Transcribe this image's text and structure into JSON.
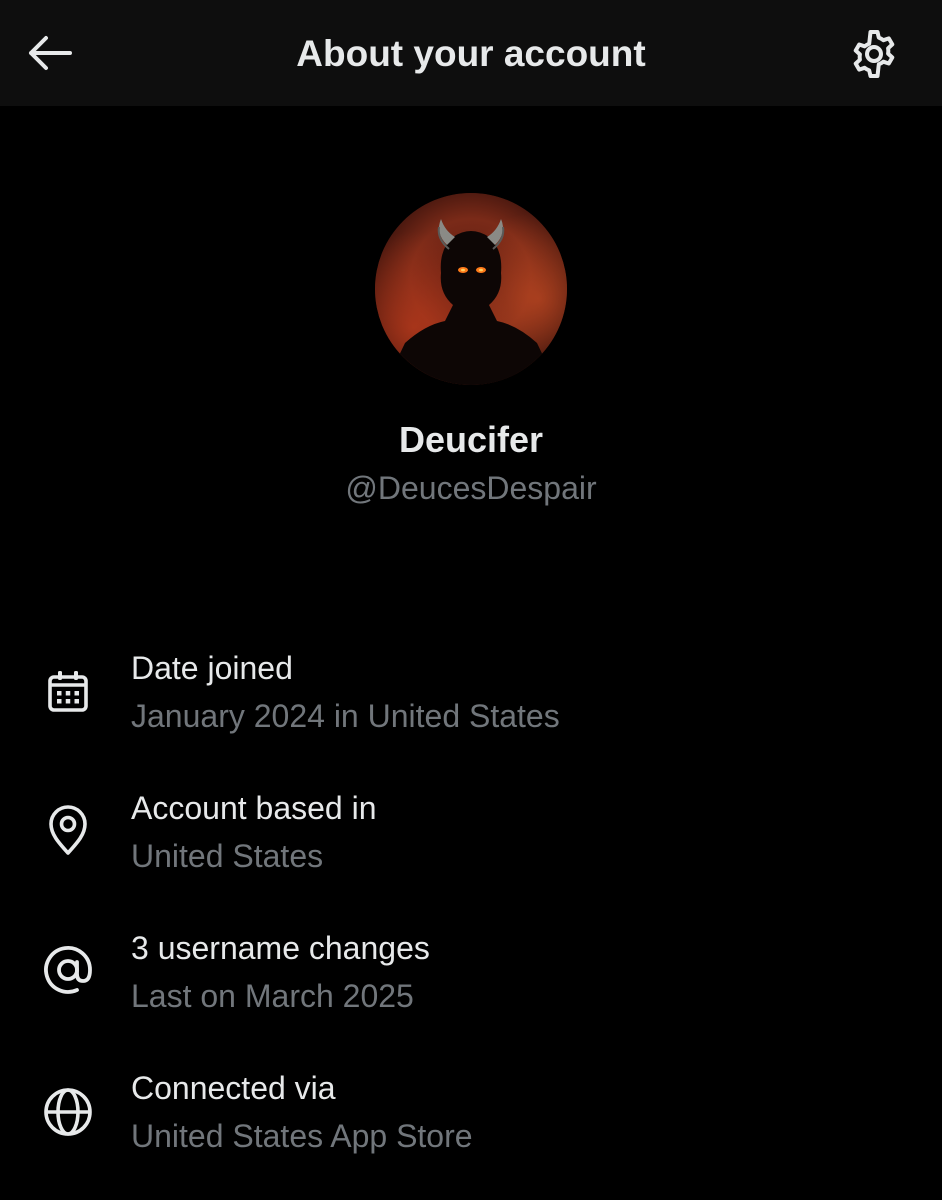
{
  "header": {
    "title": "About your account",
    "back_icon": "arrow-left-icon",
    "settings_icon": "gear-icon"
  },
  "profile": {
    "name": "Deucifer",
    "handle": "@DeucesDespair",
    "avatar": "dark-horned-figure-avatar"
  },
  "rows": [
    {
      "icon": "calendar-icon",
      "title": "Date joined",
      "subtitle": "January 2024 in United States"
    },
    {
      "icon": "location-pin-icon",
      "title": "Account based in",
      "subtitle": "United States"
    },
    {
      "icon": "at-sign-icon",
      "title": "3 username changes",
      "subtitle": "Last on March 2025"
    },
    {
      "icon": "globe-icon",
      "title": "Connected via",
      "subtitle": "United States App Store"
    }
  ],
  "colors": {
    "background": "#000000",
    "header_background": "#0e0e0e",
    "primary_text": "#e7e9ea",
    "secondary_text": "#71767b"
  }
}
